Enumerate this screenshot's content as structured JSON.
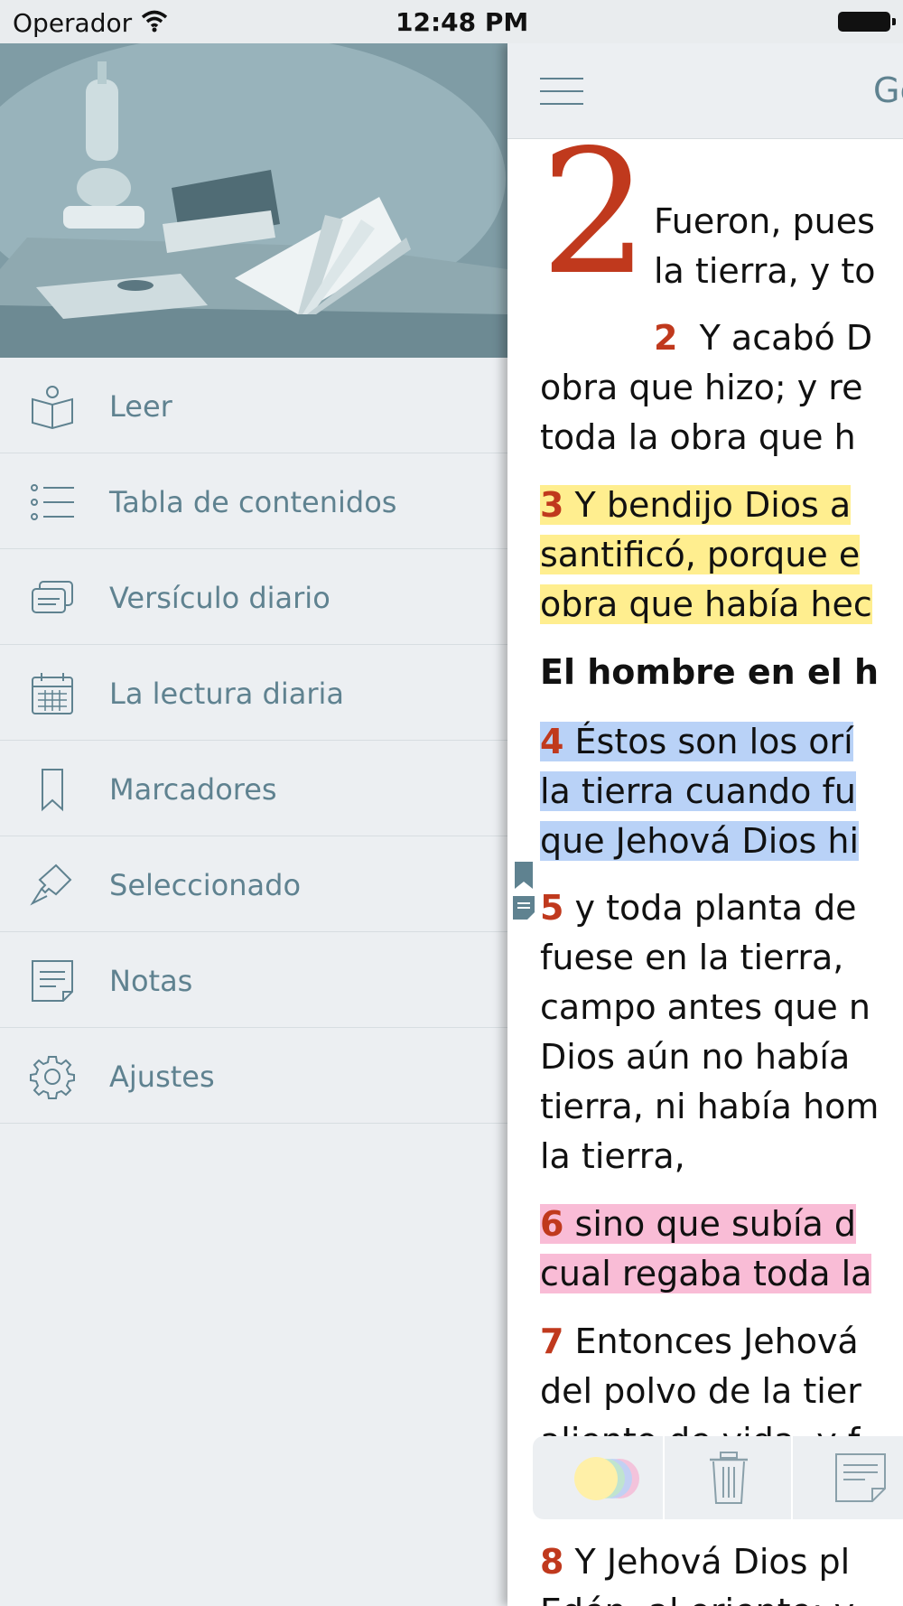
{
  "status_bar": {
    "carrier": "Operador",
    "time": "12:48 PM"
  },
  "menu": {
    "items": [
      {
        "label": "Leer",
        "icon": "book-reader-icon"
      },
      {
        "label": "Tabla de contenidos",
        "icon": "list-icon"
      },
      {
        "label": "Versículo diario",
        "icon": "cards-icon"
      },
      {
        "label": "La lectura diaria",
        "icon": "calendar-icon"
      },
      {
        "label": "Marcadores",
        "icon": "bookmark-icon"
      },
      {
        "label": "Seleccionado",
        "icon": "highlighter-icon"
      },
      {
        "label": "Notas",
        "icon": "note-icon"
      },
      {
        "label": "Ajustes",
        "icon": "gear-icon"
      }
    ]
  },
  "reader": {
    "book_title": "Gé",
    "chapter_number": "2",
    "lines": {
      "l1": "Fueron, pues",
      "l2": "la tierra, y to",
      "v2_num": "2",
      "l3": "Y acabó D",
      "l4": "obra que hizo; y re",
      "l5": "toda la obra que h",
      "v3_num": "3",
      "l6": "Y bendijo Dios a",
      "l7": "santificó, porque e",
      "l8": "obra que había hec",
      "heading": "El hombre en el h",
      "v4_num": "4",
      "l9": "Éstos son los orí",
      "l10": "la tierra cuando fu",
      "l11": "que Jehová Dios hi",
      "v5_num": "5",
      "l12": "y toda planta de",
      "l13": "fuese en la tierra,",
      "l14": "campo antes que n",
      "l15": "Dios aún no había",
      "l16": "tierra, ni había hom",
      "l17": "la tierra,",
      "v6_num": "6",
      "l18": "sino que subía d",
      "l19": "cual regaba toda la",
      "v7_num": "7",
      "l20": "Entonces Jehová",
      "l21": "del polvo de la tier",
      "l22": "aliento de vida, y f",
      "v8_num": "8",
      "l23": "Y Jehová Dios pl",
      "l24": "Edén, al oriente; y"
    },
    "highlight_colors": {
      "yellow": "#ffee8f",
      "blue": "#b9d2f7",
      "pink": "#f9bcd6"
    }
  },
  "toolbar": {
    "icons": [
      "color-picker-icon",
      "trash-icon",
      "note-icon"
    ]
  },
  "colors": {
    "accent": "#5f8290",
    "verse_number": "#c0391d"
  }
}
